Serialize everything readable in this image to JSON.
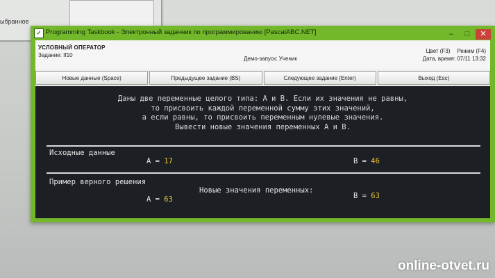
{
  "background": {
    "left_window_text": "ыбранное"
  },
  "window": {
    "title": "Programming Taskbook - Электронный задачник по программированию [PascalABC.NET]",
    "controls": {
      "minimize": "–",
      "maximize": "□",
      "close": "✕"
    }
  },
  "info": {
    "group": "УСЛОВНЫЙ ОПЕРАТОР",
    "task": "Задание: If10",
    "demo": "Демо-запуск: Ученик",
    "color": "Цвет (F3)",
    "mode": "Режим (F4)",
    "datetime": "Дата, время: 07/11 13:32"
  },
  "buttons": {
    "new_data": "Новые данные (Space)",
    "prev_task": "Предыдущее задание (BS)",
    "next_task": "Следующее задание (Enter)",
    "exit": "Выход (Esc)"
  },
  "console": {
    "condition": [
      "Даны две переменные целого типа: A и B. Если их значения не равны,",
      "то присвоить каждой переменной сумму этих значений,",
      "а если равны, то присвоить переменным нулевые значения.",
      "Вывести новые значения переменных A и B."
    ],
    "input_title": "Исходные данные",
    "input": {
      "a_label": "A = ",
      "a_value": "17",
      "b_label": "B = ",
      "b_value": "46"
    },
    "example_title": "Пример верного решения",
    "example_caption": "Новые значения переменных:",
    "example": {
      "a_label": "A = ",
      "a_value": "63",
      "b_label": "B = ",
      "b_value": "63"
    }
  },
  "watermark": "online-otvet.ru",
  "colors": {
    "title_bar": "#73b82a",
    "console_bg": "#1c1f24",
    "value": "#e8c233"
  }
}
